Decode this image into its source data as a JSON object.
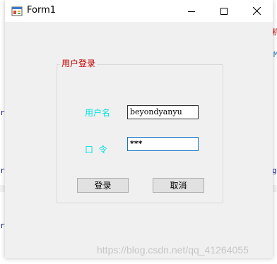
{
  "window": {
    "title": "Form1"
  },
  "background": {
    "fragments": [
      "机",
      "M",
      "ri",
      "ri",
      "gs",
      "ri"
    ]
  },
  "form": {
    "group_caption": "用户登录",
    "username_label": "用户名",
    "password_label": "口  令",
    "username_value": "beyondyanyu",
    "password_value": "***",
    "login_label": "登录",
    "cancel_label": "取消"
  },
  "watermark": "https://blog.csdn.net/qq_41264055",
  "colors": {
    "label": "#00e0e0",
    "caption": "#c00000",
    "focus_border": "#1a75c8"
  }
}
